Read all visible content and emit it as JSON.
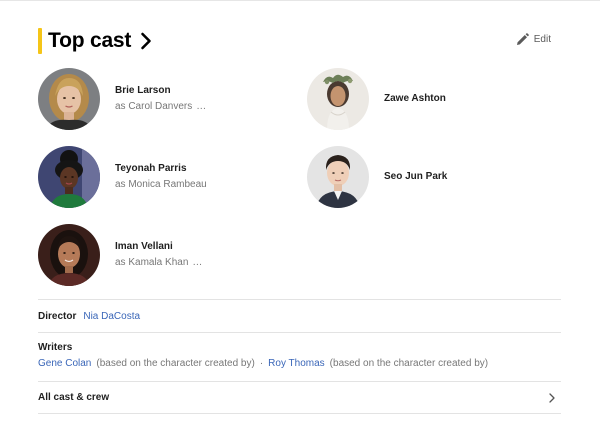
{
  "header": {
    "title": "Top cast",
    "edit_label": "Edit",
    "accent_color": "#f5c518"
  },
  "cast": [
    {
      "actor": "Brie Larson",
      "role": "as Carol Danvers",
      "has_more": true,
      "icon": "portrait-blonde-woman"
    },
    {
      "actor": "Zawe Ashton",
      "role": "",
      "has_more": false,
      "icon": "portrait-woman-floral-crown"
    },
    {
      "actor": "Teyonah Parris",
      "role": "as Monica Rambeau",
      "has_more": false,
      "icon": "portrait-woman-curly-hair"
    },
    {
      "actor": "Seo Jun Park",
      "role": "",
      "has_more": false,
      "icon": "portrait-man-suit"
    },
    {
      "actor": "Iman Vellani",
      "role": "as Kamala Khan",
      "has_more": true,
      "icon": "portrait-young-woman-dark-hair"
    }
  ],
  "more_marker": "…",
  "director": {
    "label": "Director",
    "name": "Nia DaCosta"
  },
  "writers": {
    "label": "Writers",
    "separator": "·",
    "items": [
      {
        "name": "Gene Colan",
        "note": "(based on the character created by)"
      },
      {
        "name": "Roy Thomas",
        "note": "(based on the character created by)"
      }
    ]
  },
  "all_cast": {
    "label": "All cast & crew"
  },
  "colors": {
    "link": "#3a66b8",
    "muted": "#777777",
    "divider": "#e3e3e3"
  }
}
